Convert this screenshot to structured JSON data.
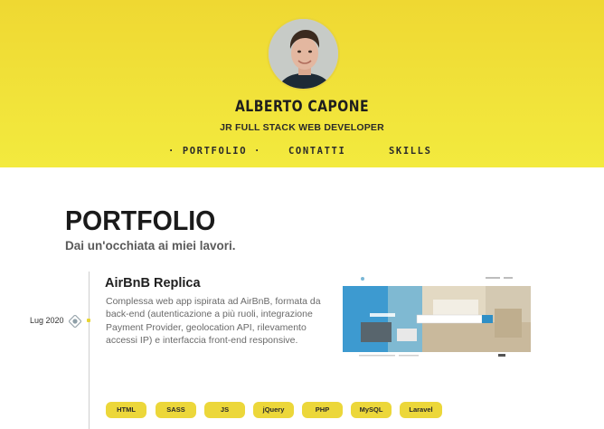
{
  "header": {
    "name": "ALBERTO CAPONE",
    "role": "JR FULL STACK WEB DEVELOPER",
    "nav": [
      {
        "label": "· PORTFOLIO ·"
      },
      {
        "label": "CONTATTI"
      },
      {
        "label": "SKILLS"
      }
    ]
  },
  "portfolio": {
    "title": "PORTFOLIO",
    "subtitle": "Dai un'occhiata ai miei lavori.",
    "projects": [
      {
        "date": "Lug 2020",
        "title": "AirBnB Replica",
        "description": "Complessa web app ispirata ad AirBnB, formata da back-end (autenticazione a più ruoli, integrazione Payment Provider, geolocation API, rilevamento accessi IP) e interfaccia front-end responsive.",
        "tags": [
          "HTML",
          "SASS",
          "JS",
          "jQuery",
          "PHP",
          "MySQL",
          "Laravel"
        ]
      }
    ]
  },
  "colors": {
    "accent": "#efd832",
    "tag": "#ecd73a",
    "text": "#1f1f1f",
    "muted": "#6a6a6a"
  }
}
